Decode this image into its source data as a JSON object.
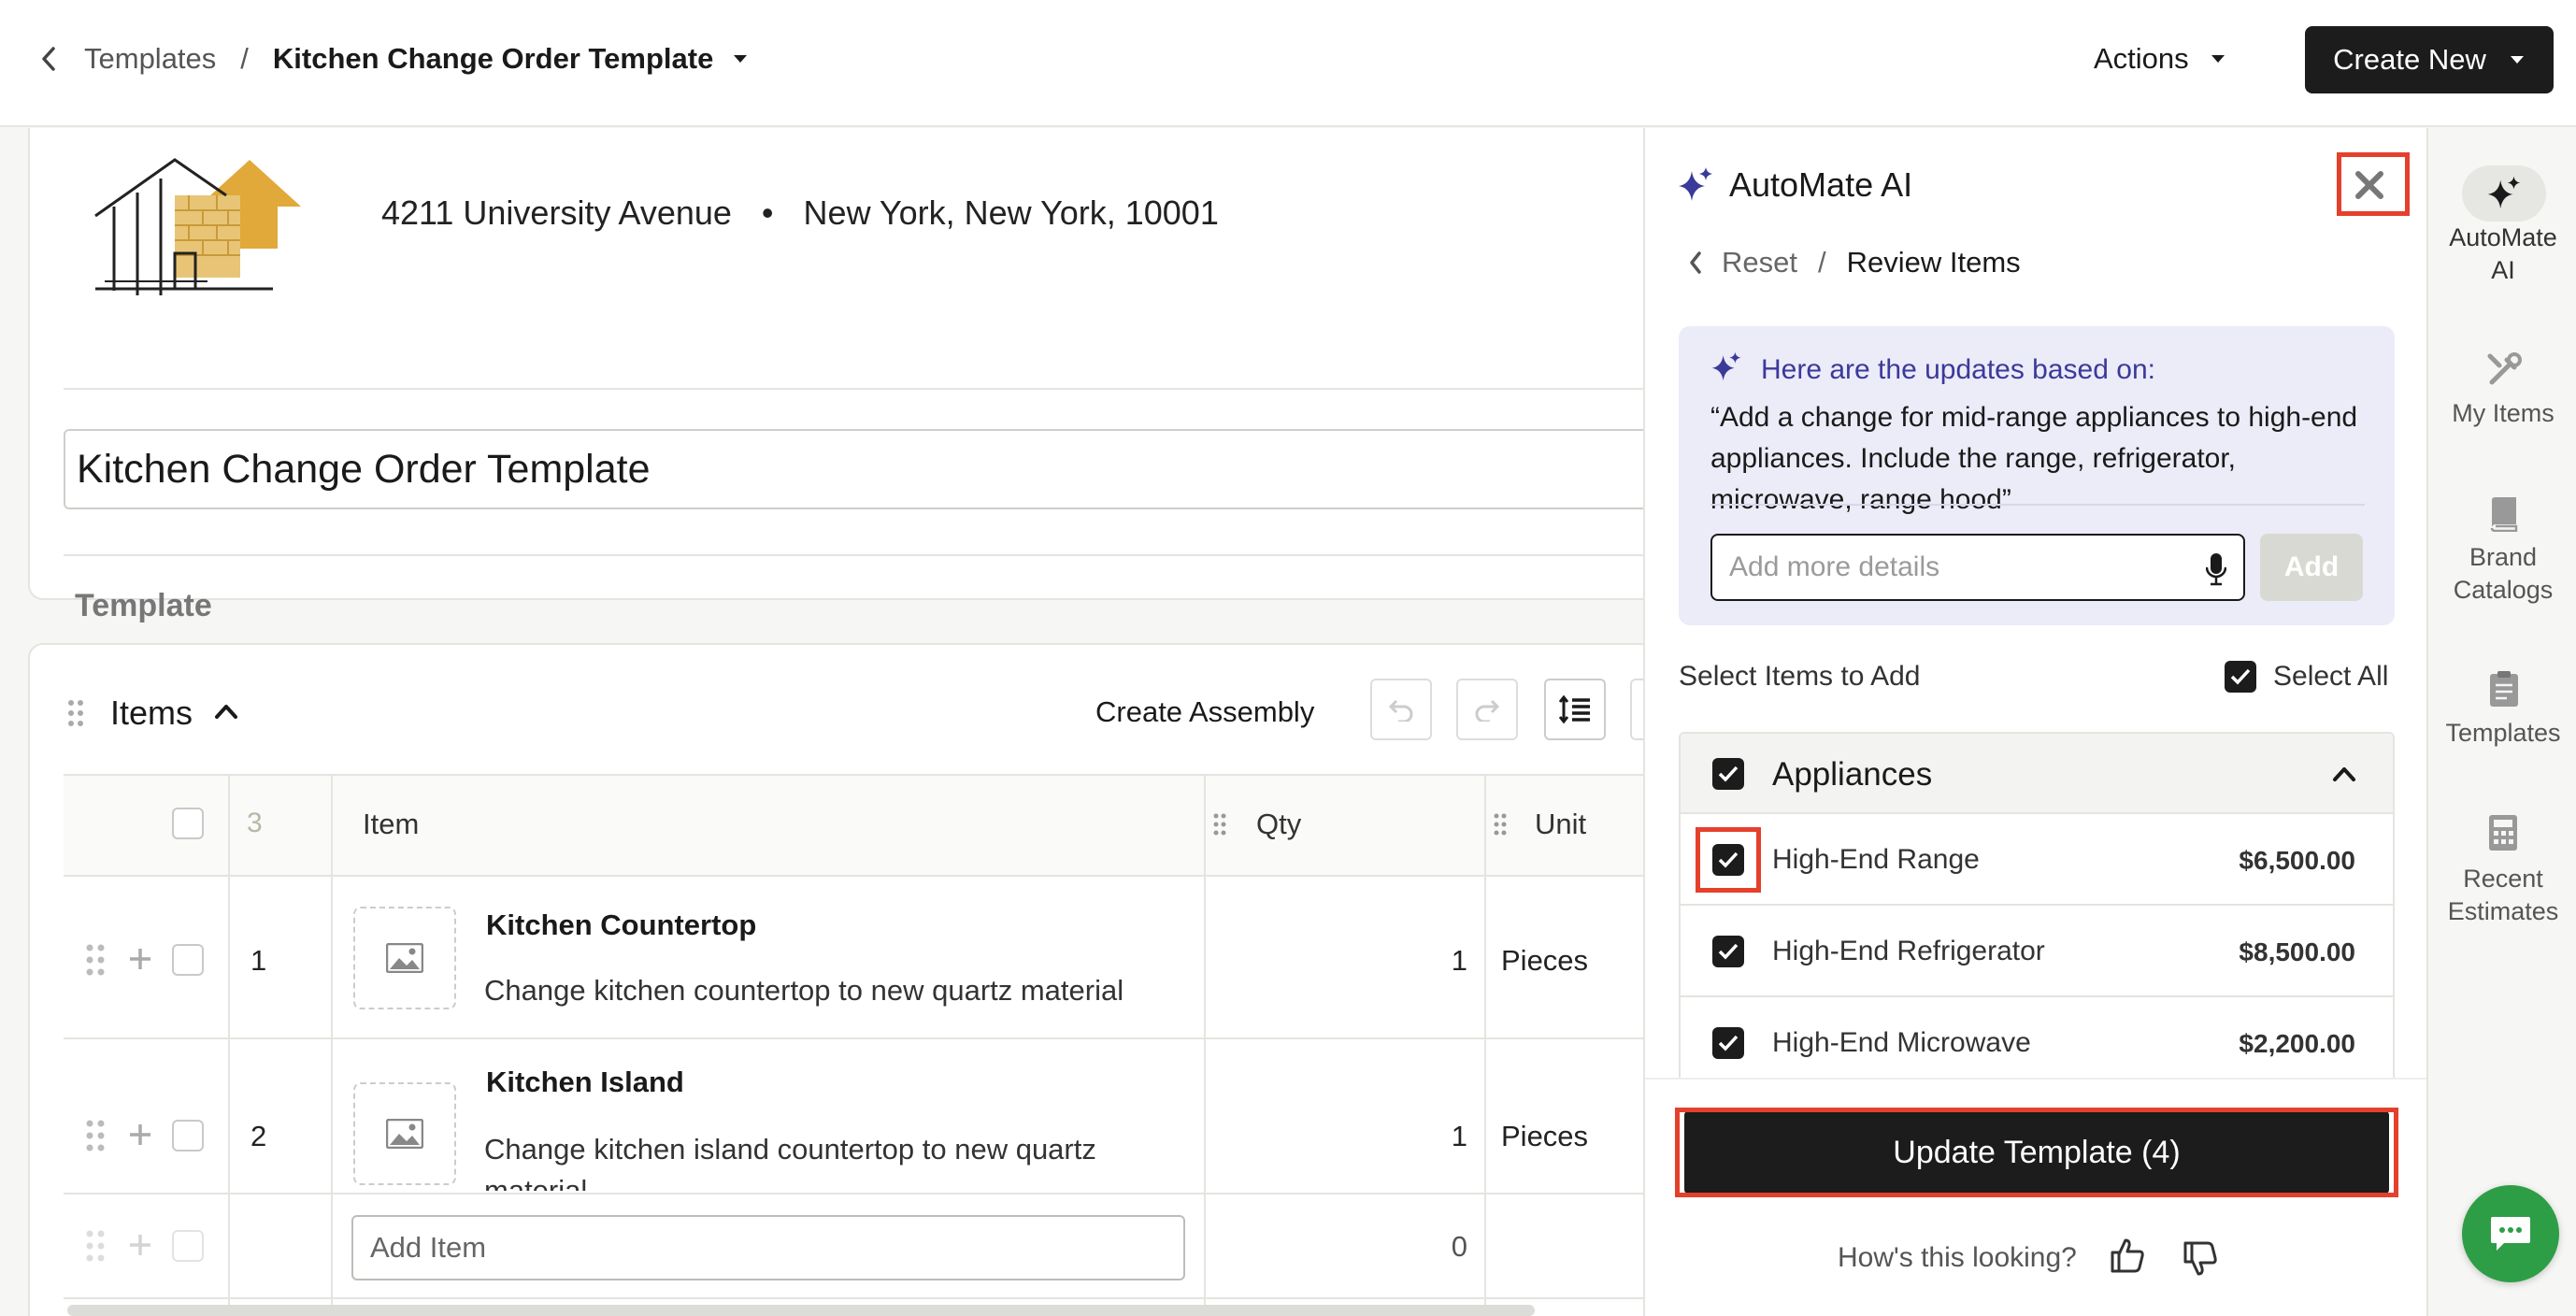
{
  "topbar": {
    "breadcrumb_parent": "Templates",
    "breadcrumb_separator": "/",
    "breadcrumb_current": "Kitchen Change Order Template",
    "actions_label": "Actions",
    "create_new_label": "Create New"
  },
  "header_card": {
    "address": "4211 University Avenue",
    "bullet": "•",
    "city": "New York, New York, 10001",
    "title_value": "Kitchen Change Order Template",
    "type_label": "Template"
  },
  "items_card": {
    "title": "Items",
    "create_assembly_label": "Create Assembly",
    "columns": {
      "count": "3",
      "item": "Item",
      "qty": "Qty",
      "unit": "Unit"
    },
    "rows": [
      {
        "num": "1",
        "name": "Kitchen Countertop",
        "description": "Change kitchen countertop to new quartz material",
        "qty": "1",
        "unit": "Pieces"
      },
      {
        "num": "2",
        "name": "Kitchen Island",
        "description": "Change kitchen island countertop to new quartz material",
        "qty": "1",
        "unit": "Pieces"
      }
    ],
    "add_item_placeholder": "Add Item",
    "add_item_qty": "0"
  },
  "ai_panel": {
    "title": "AutoMate AI",
    "breadcrumb_reset": "Reset",
    "breadcrumb_separator": "/",
    "breadcrumb_current": "Review Items",
    "updates_heading": "Here are the updates based on:",
    "prompt_quote": "“Add a change for mid-range appliances to high-end appliances. Include the range, refrigerator, microwave, range hood”",
    "details_placeholder": "Add more details",
    "add_label": "Add",
    "select_items_label": "Select Items to Add",
    "select_all_label": "Select All",
    "group_name": "Appliances",
    "group_items": [
      {
        "name": "High-End Range",
        "price": "$6,500.00"
      },
      {
        "name": "High-End Refrigerator",
        "price": "$8,500.00"
      },
      {
        "name": "High-End Microwave",
        "price": "$2,200.00"
      }
    ],
    "update_button_label": "Update Template (4)",
    "feedback_prompt": "How's this looking?"
  },
  "rail": {
    "items": [
      {
        "label_line1": "AutoMate",
        "label_line2": "AI",
        "icon": "sparkle-icon"
      },
      {
        "label_line1": "My Items",
        "label_line2": "",
        "icon": "tools-icon"
      },
      {
        "label_line1": "Brand",
        "label_line2": "Catalogs",
        "icon": "book-icon"
      },
      {
        "label_line1": "Templates",
        "label_line2": "",
        "icon": "clipboard-icon"
      },
      {
        "label_line1": "Recent",
        "label_line2": "Estimates",
        "icon": "calculator-icon"
      }
    ]
  },
  "colors": {
    "accent_dark": "#1c1c1c",
    "highlight_red": "#e4402c",
    "ai_purple": "#3a3a9a",
    "ai_panel_bg": "#ecebf8",
    "chat_green": "#2e9e46",
    "logo_yellow": "#e0a93a"
  }
}
